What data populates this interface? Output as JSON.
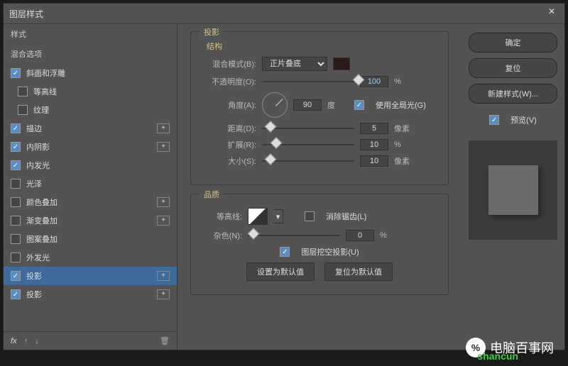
{
  "title": "图层样式",
  "left": {
    "styles": "样式",
    "blendopt": "混合选项",
    "items": [
      {
        "label": "斜面和浮雕",
        "on": true,
        "plus": false
      },
      {
        "label": "等高线",
        "on": false,
        "plus": false,
        "sub": true
      },
      {
        "label": "纹理",
        "on": false,
        "plus": false,
        "sub": true
      },
      {
        "label": "描边",
        "on": true,
        "plus": true
      },
      {
        "label": "内阴影",
        "on": true,
        "plus": true
      },
      {
        "label": "内发光",
        "on": true,
        "plus": false
      },
      {
        "label": "光泽",
        "on": false,
        "plus": false
      },
      {
        "label": "颜色叠加",
        "on": false,
        "plus": true
      },
      {
        "label": "渐变叠加",
        "on": false,
        "plus": true
      },
      {
        "label": "图案叠加",
        "on": false,
        "plus": false
      },
      {
        "label": "外发光",
        "on": false,
        "plus": false
      },
      {
        "label": "投影",
        "on": true,
        "plus": true,
        "sel": true
      },
      {
        "label": "投影",
        "on": true,
        "plus": true
      }
    ],
    "fx": "fx"
  },
  "center": {
    "mainbox": "投影",
    "struct": "结构",
    "blendmode": "混合模式(B):",
    "blendval": "正片叠底",
    "opacity": "不透明度(O):",
    "opval": "100",
    "pct": "%",
    "angle": "角度(A):",
    "angval": "90",
    "deg": "度",
    "global": "使用全局光(G)",
    "dist": "距离(D):",
    "distval": "5",
    "px": "像素",
    "spread": "扩展(R):",
    "spreadval": "10",
    "size": "大小(S):",
    "sizeval": "10",
    "quality": "品质",
    "contour": "等高线:",
    "antialias": "消除锯齿(L)",
    "noise": "杂色(N):",
    "noiseval": "0",
    "knockout": "图层挖空投影(U)",
    "setdefault": "设置为默认值",
    "resetdefault": "复位为默认值"
  },
  "right": {
    "ok": "确定",
    "cancel": "复位",
    "newstyle": "新建样式(W)...",
    "preview": "预览(V)"
  },
  "watermark": {
    "brand": "电脑百事网",
    "sub": "shancun"
  }
}
